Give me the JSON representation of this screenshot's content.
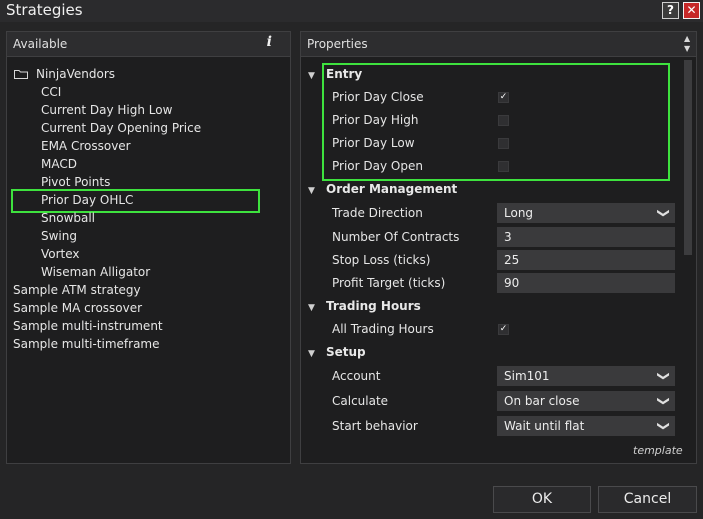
{
  "window": {
    "title": "Strategies",
    "help": "?",
    "close": "✕"
  },
  "left": {
    "header": "Available",
    "info_glyph": "i",
    "folder": "NinjaVendors",
    "vendor_items": [
      "CCI",
      "Current Day High Low",
      "Current Day Opening Price",
      "EMA Crossover",
      "MACD",
      "Pivot Points",
      "Prior Day OHLC",
      "Snowball",
      "Swing",
      "Vortex",
      "Wiseman Alligator"
    ],
    "samples": [
      "Sample ATM strategy",
      "Sample MA crossover",
      "Sample multi-instrument",
      "Sample multi-timeframe"
    ],
    "selected": "Prior Day OHLC"
  },
  "right": {
    "header": "Properties",
    "entry": {
      "title": "Entry",
      "rows": [
        {
          "label": "Prior Day Close",
          "checked": true
        },
        {
          "label": "Prior Day High",
          "checked": false
        },
        {
          "label": "Prior Day Low",
          "checked": false
        },
        {
          "label": "Prior Day Open",
          "checked": false
        }
      ]
    },
    "order": {
      "title": "Order Management",
      "trade_direction_label": "Trade Direction",
      "trade_direction_value": "Long",
      "contracts_label": "Number Of Contracts",
      "contracts_value": "3",
      "stop_label": "Stop Loss (ticks)",
      "stop_value": "25",
      "target_label": "Profit Target (ticks)",
      "target_value": "90"
    },
    "hours": {
      "title": "Trading Hours",
      "all_label": "All Trading Hours",
      "all_checked": true
    },
    "setup": {
      "title": "Setup",
      "account_label": "Account",
      "account_value": "Sim101",
      "calculate_label": "Calculate",
      "calculate_value": "On bar close",
      "start_label": "Start behavior",
      "start_value": "Wait until flat"
    },
    "template_link": "template"
  },
  "buttons": {
    "ok": "OK",
    "cancel": "Cancel"
  },
  "glyphs": {
    "expanded": "▼",
    "check": "✓",
    "chevron": "❯",
    "scroll_up": "▲",
    "scroll_down": "▼"
  },
  "colors": {
    "highlight": "#3ee23e",
    "close_button": "#c62828"
  }
}
